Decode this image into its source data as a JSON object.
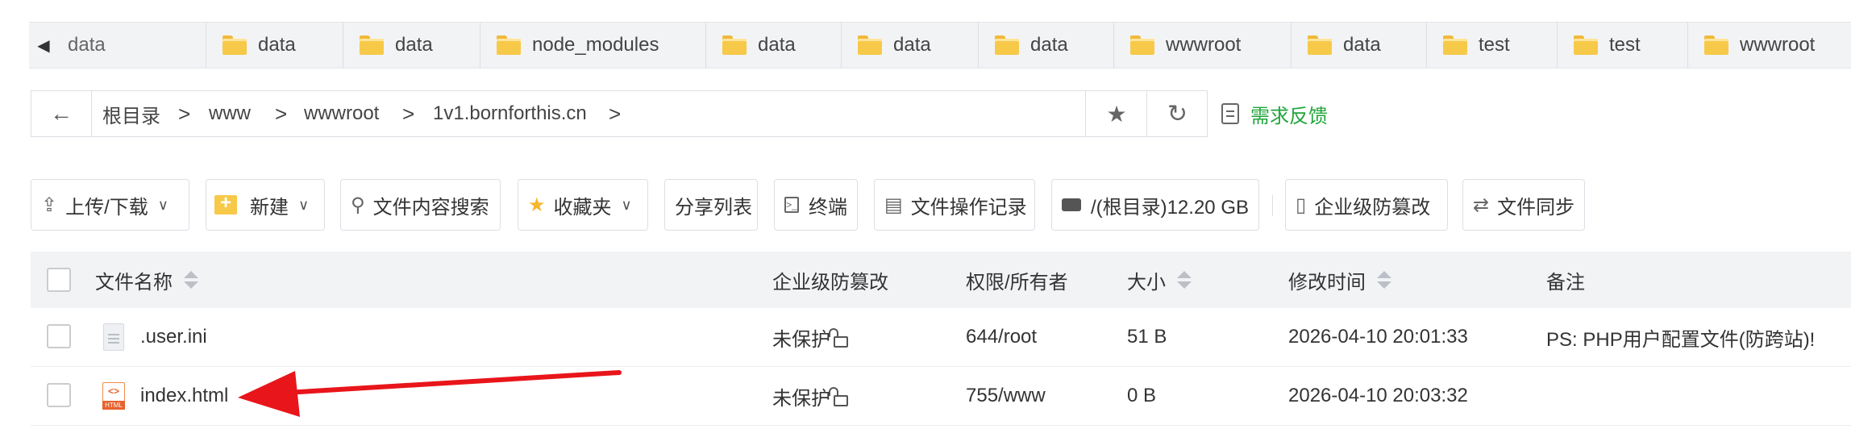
{
  "folder_tabs": [
    {
      "label": "data"
    },
    {
      "label": "data"
    },
    {
      "label": "data"
    },
    {
      "label": "node_modules"
    },
    {
      "label": "data"
    },
    {
      "label": "data"
    },
    {
      "label": "data"
    },
    {
      "label": "wwwroot"
    },
    {
      "label": "data"
    },
    {
      "label": "test"
    },
    {
      "label": "test"
    },
    {
      "label": "wwwroot"
    }
  ],
  "breadcrumb": {
    "items": [
      "根目录",
      "www",
      "wwwroot",
      "1v1.bornforthis.cn"
    ],
    "separator": ">"
  },
  "feedback_label": "需求反馈",
  "toolbar": {
    "upload_download": "上传/下载",
    "new": "新建",
    "content_search": "文件内容搜索",
    "favorites": "收藏夹",
    "share_list": "分享列表",
    "terminal": "终端",
    "operation_log": "文件操作记录",
    "disk": "/(根目录)12.20 GB",
    "tamper_protect": "企业级防篡改",
    "file_sync": "文件同步"
  },
  "table": {
    "headers": {
      "name": "文件名称",
      "tamper": "企业级防篡改",
      "perm_owner": "权限/所有者",
      "size": "大小",
      "mtime": "修改时间",
      "note": "备注"
    },
    "rows": [
      {
        "name": ".user.ini",
        "type": "ini",
        "tamper": "未保护",
        "perm": "644/root",
        "size": "51 B",
        "mtime": "2026-04-10 20:01:33",
        "note": "PS: PHP用户配置文件(防跨站)!"
      },
      {
        "name": "index.html",
        "type": "html",
        "tamper": "未保护",
        "perm": "755/www",
        "size": "0 B",
        "mtime": "2026-04-10 20:03:32",
        "note": ""
      }
    ]
  },
  "colors": {
    "accent_green": "#20a53a",
    "annotation_arrow": "#e8151b"
  }
}
